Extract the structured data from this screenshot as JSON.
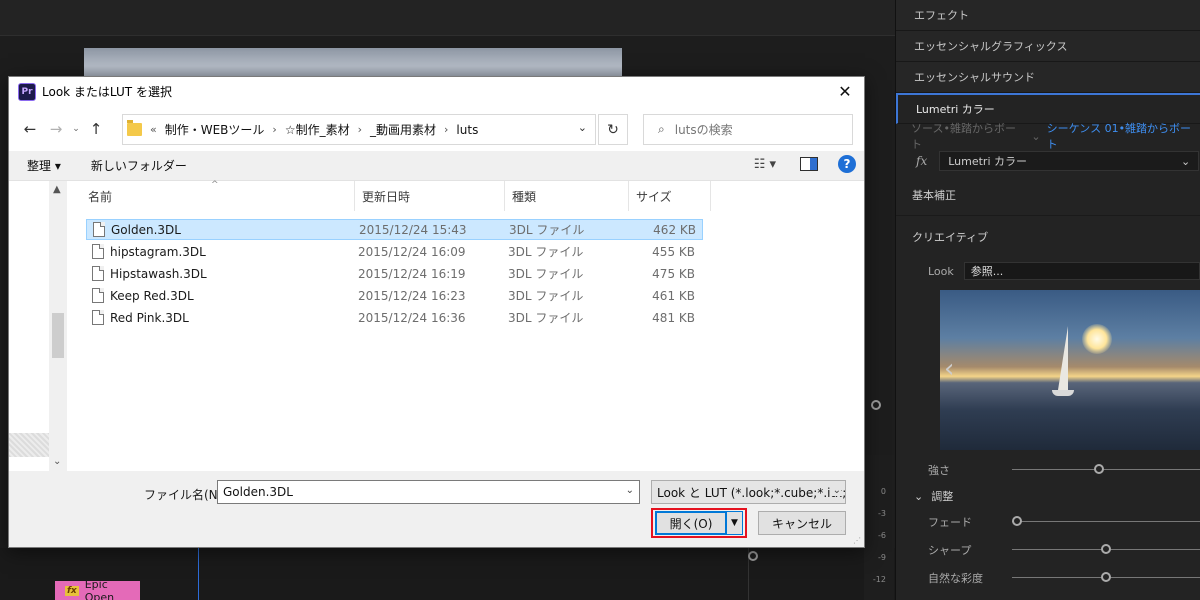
{
  "premiere": {
    "panel_tabs": [
      {
        "label": "エフェクト"
      },
      {
        "label": "エッセンシャルグラフィックス"
      },
      {
        "label": "エッセンシャルサウンド"
      },
      {
        "label": "Lumetri カラー"
      }
    ],
    "source_label": "ソース•雑踏からボート",
    "sequence_label": "シーケンス 01•雑踏からボート",
    "fx_symbol": "fx",
    "effect_name": "Lumetri カラー",
    "section_basic": "基本補正",
    "section_creative": "クリエイティブ",
    "look_label": "Look",
    "look_value": "参照...",
    "intensity_label": "強さ",
    "intensity_value": 0.46,
    "adjust_label": "調整",
    "fade_label": "フェード",
    "fade_value": 0.0,
    "sharpen_label": "シャープ",
    "sharpen_value": 0.5,
    "vibrance_label": "自然な彩度",
    "vibrance_value": 0.5,
    "clip_label": "Epic Open",
    "clip_fx": "fx",
    "meter_labels": [
      "0",
      "-3",
      "-6",
      "-9",
      "-12"
    ]
  },
  "dialog": {
    "title": "Look またはLUT を選択",
    "app_icon": "Pr",
    "breadcrumb_overflow": "«",
    "breadcrumbs": [
      "制作・WEBツール",
      "☆制作_素材",
      "_動画用素材",
      "luts"
    ],
    "search_placeholder": "lutsの検索",
    "organize_label": "整理 ▾",
    "new_folder_label": "新しいフォルダー",
    "help_label": "?",
    "columns": {
      "name": "名前",
      "date": "更新日時",
      "type": "種類",
      "size": "サイズ"
    },
    "files": [
      {
        "name": "Golden.3DL",
        "date": "2015/12/24 15:43",
        "type": "3DL ファイル",
        "size": "462 KB"
      },
      {
        "name": "hipstagram.3DL",
        "date": "2015/12/24 16:09",
        "type": "3DL ファイル",
        "size": "455 KB"
      },
      {
        "name": "Hipstawash.3DL",
        "date": "2015/12/24 16:19",
        "type": "3DL ファイル",
        "size": "475 KB"
      },
      {
        "name": "Keep Red.3DL",
        "date": "2015/12/24 16:23",
        "type": "3DL ファイル",
        "size": "461 KB"
      },
      {
        "name": "Red Pink.3DL",
        "date": "2015/12/24 16:36",
        "type": "3DL ファイル",
        "size": "481 KB"
      }
    ],
    "filename_label": "ファイル名(N):",
    "filename_value": "Golden.3DL",
    "filter_value": "Look と LUT (*.look;*.cube;*.itx;",
    "open_label": "開く(O)",
    "cancel_label": "キャンセル"
  },
  "colors": {
    "highlight": "#e5121f",
    "selection": "#cce8ff",
    "accent": "#0078d7"
  }
}
